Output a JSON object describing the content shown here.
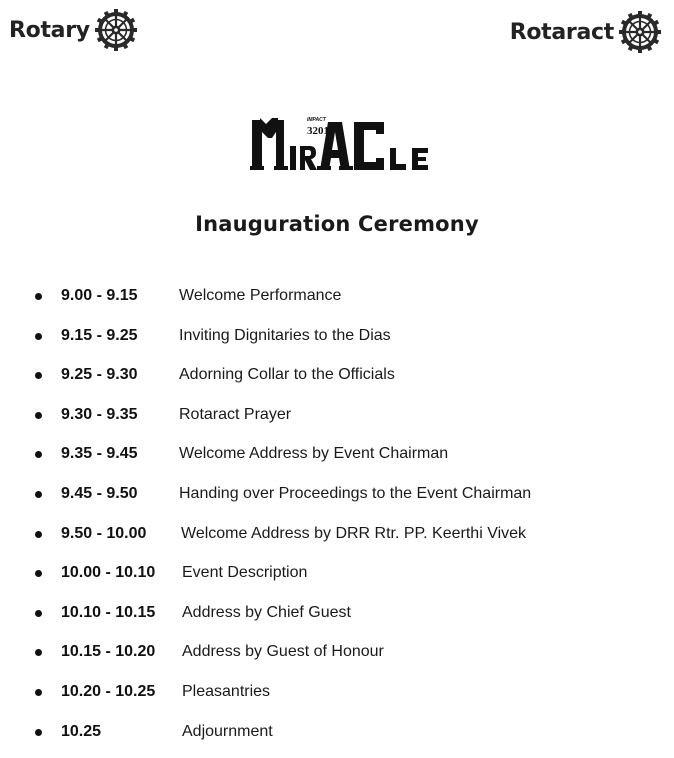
{
  "header": {
    "left_logo_text": "Rotary",
    "right_logo_text": "Rotaract"
  },
  "event_logo": {
    "name": "MIRACLE",
    "tag_small": "IMPACT",
    "tag_number": "3201"
  },
  "title": "Inauguration Ceremony",
  "schedule": [
    {
      "time": "9.00 - 9.15",
      "description": "Welcome Performance"
    },
    {
      "time": "9.15 - 9.25",
      "description": "Inviting Dignitaries to the Dias"
    },
    {
      "time": "9.25 - 9.30",
      "description": "Adorning Collar to the Officials"
    },
    {
      "time": "9.30 - 9.35",
      "description": "Rotaract Prayer"
    },
    {
      "time": "9.35 - 9.45",
      "description": "Welcome Address by Event Chairman"
    },
    {
      "time": "9.45 - 9.50",
      "description": "Handing over Proceedings to the Event Chairman"
    },
    {
      "time": "9.50 - 10.00",
      "description": "Welcome Address by DRR Rtr. PP. Keerthi Vivek"
    },
    {
      "time": "10.00 - 10.10",
      "description": "Event Description"
    },
    {
      "time": "10.10 - 10.15",
      "description": "Address by Chief Guest"
    },
    {
      "time": "10.15 - 10.20",
      "description": "Address by Guest of Honour"
    },
    {
      "time": "10.20 - 10.25",
      "description": "Pleasantries"
    },
    {
      "time": "10.25",
      "description": "Adjournment"
    }
  ],
  "colors": {
    "text": "#111111",
    "wheel": "#2a2a2a"
  }
}
